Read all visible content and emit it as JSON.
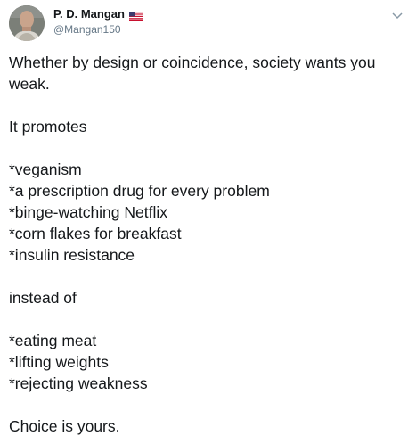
{
  "author": {
    "display_name": "P. D. Mangan",
    "handle": "@Mangan150",
    "flag_icon": "us-flag-icon",
    "avatar_icon": "profile-photo"
  },
  "menu_icon": "chevron-down-icon",
  "tweet": {
    "paragraph1": "Whether by design or coincidence, society wants you weak.",
    "paragraph2": "It promotes",
    "promotes": [
      "*veganism",
      "*a prescription drug for every problem",
      "*binge-watching Netflix",
      "*corn flakes for breakfast",
      "*insulin resistance"
    ],
    "paragraph3": "instead of",
    "instead": [
      "*eating meat",
      "*lifting weights",
      "*rejecting weakness"
    ],
    "paragraph4": "Choice is yours."
  },
  "colors": {
    "text": "#14171a",
    "secondary": "#657786"
  }
}
